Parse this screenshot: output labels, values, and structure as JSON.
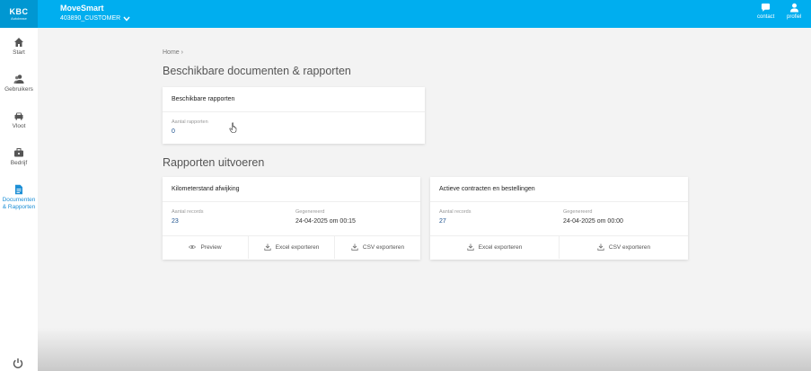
{
  "header": {
    "logo_text": "KBC",
    "logo_subtext": "Autolease",
    "app_title": "MoveSmart",
    "customer": "403890_CUSTOMER",
    "actions": [
      {
        "label": "contact",
        "icon": "chat-icon"
      },
      {
        "label": "profiel",
        "icon": "user-icon"
      }
    ]
  },
  "sidebar": {
    "items": [
      {
        "label": "Start",
        "icon": "home-icon"
      },
      {
        "label": "Gebruikers",
        "icon": "users-icon"
      },
      {
        "label": "Vloot",
        "icon": "car-icon"
      },
      {
        "label": "Bedrijf",
        "icon": "briefcase-icon"
      },
      {
        "label": "Documenten & Rapporten",
        "icon": "document-icon",
        "active": true
      }
    ],
    "power_icon": "power-icon"
  },
  "breadcrumb": "Home ›",
  "section_documents": {
    "title": "Beschikbare documenten & rapporten",
    "card_title": "Beschikbare rapporten",
    "stat_label": "Aantal rapporten",
    "stat_value": "0"
  },
  "section_reports": {
    "title": "Rapporten uitvoeren",
    "cards": [
      {
        "title": "Kilometerstand afwijking",
        "records_label": "Aantal records",
        "records_value": "23",
        "generated_label": "Gegenereerd",
        "generated_value": "24-04-2025 om 00:15",
        "actions": [
          {
            "label": "Preview",
            "icon": "eye-icon"
          },
          {
            "label": "Excel exporteren",
            "icon": "download-icon"
          },
          {
            "label": "CSV exporteren",
            "icon": "download-icon"
          }
        ]
      },
      {
        "title": "Actieve contracten en bestellingen",
        "records_label": "Aantal records",
        "records_value": "27",
        "generated_label": "Gegenereerd",
        "generated_value": "24-04-2025 om 00:00",
        "actions": [
          {
            "label": "Excel exporteren",
            "icon": "download-icon"
          },
          {
            "label": "CSV exporteren",
            "icon": "download-icon"
          }
        ]
      }
    ]
  },
  "colors": {
    "topbar": "#00aeef",
    "accent": "#1d8fd6",
    "value": "#1a4f8c"
  }
}
